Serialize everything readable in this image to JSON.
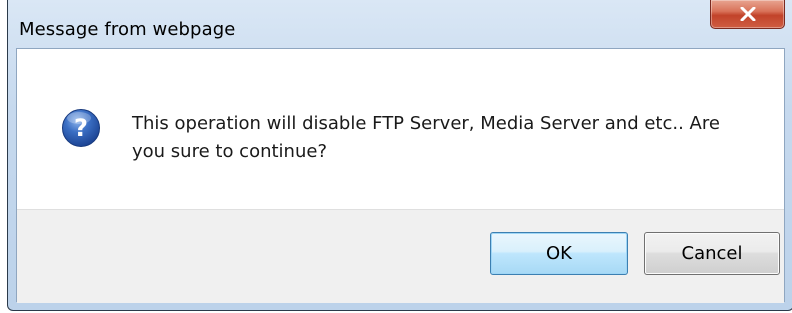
{
  "window": {
    "title": "Message from webpage"
  },
  "dialog": {
    "icon": "question-icon",
    "message": "This operation will disable FTP Server, Media Server and etc.. Are you sure to continue?"
  },
  "buttons": {
    "ok_label": "OK",
    "cancel_label": "Cancel"
  },
  "colors": {
    "close_button": "#c94a30",
    "icon_blue": "#2a5ab0",
    "ok_border": "#3c7fb1"
  }
}
